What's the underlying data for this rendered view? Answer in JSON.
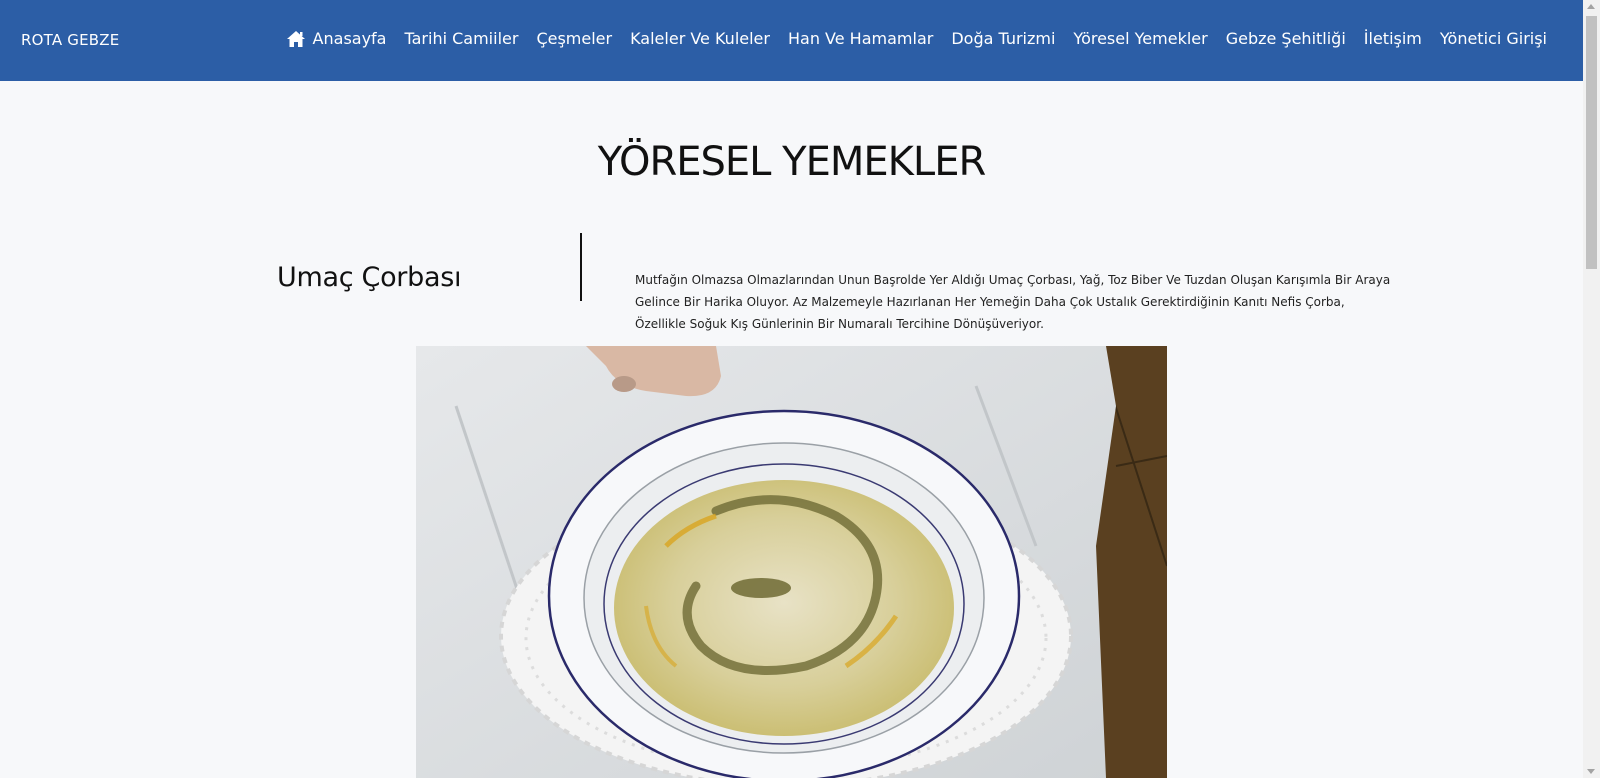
{
  "navbar": {
    "brand": "ROTA GEBZE",
    "background": "#2c5ea6",
    "home_icon": "home-icon",
    "links": [
      {
        "label": "Anasayfa"
      },
      {
        "label": "Tarihi Camiiler"
      },
      {
        "label": "Çeşmeler"
      },
      {
        "label": "Kaleler Ve Kuleler"
      },
      {
        "label": "Han Ve Hamamlar"
      },
      {
        "label": "Doğa Turizmi"
      },
      {
        "label": "Yöresel Yemekler"
      },
      {
        "label": "Gebze Şehitliği"
      },
      {
        "label": "İletişim"
      },
      {
        "label": "Yönetici Girişi"
      }
    ]
  },
  "main": {
    "title": "YÖRESEL YEMEKLER",
    "dish": {
      "name": "Umaç Çorbası",
      "description": "Mutfağın Olmazsa Olmazlarından Unun Başrolde Yer Aldığı Umaç Çorbası, Yağ, Toz Biber Ve Tuzdan Oluşan Karışımla Bir Araya Gelince Bir Harika Oluyor. Az Malzemeyle Hazırlanan Her Yemeğin Daha Çok Ustalık Gerektirdiğinin Kanıtı Nefis Çorba, Özellikle Soğuk Kış Günlerinin Bir Numaralı Tercihine Dönüşüveriyor."
    }
  }
}
